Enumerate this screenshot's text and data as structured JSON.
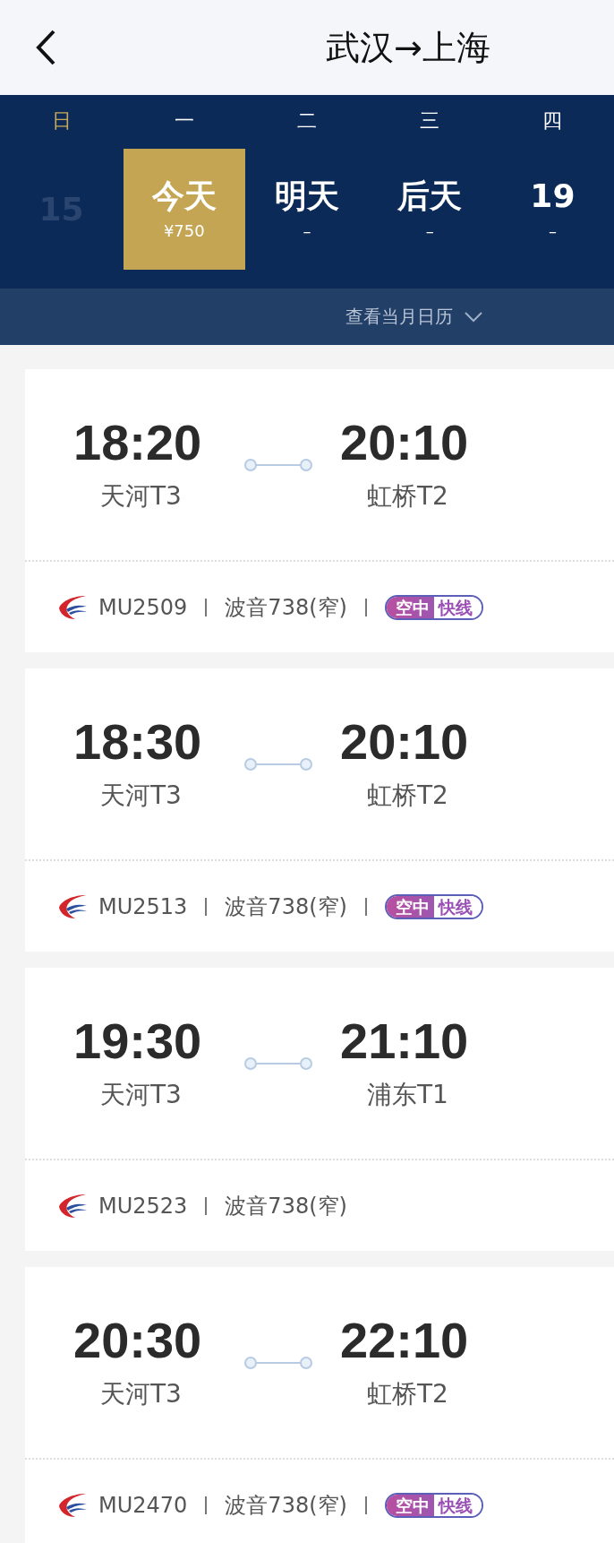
{
  "header": {
    "title": "武汉→上海"
  },
  "days": [
    {
      "weekday": "日",
      "label": "15",
      "weekend": true,
      "disabled": true,
      "selected": false
    },
    {
      "weekday": "一",
      "label": "今天",
      "price": "¥750",
      "weekend": false,
      "disabled": false,
      "selected": true
    },
    {
      "weekday": "二",
      "label": "明天",
      "price": "–",
      "weekend": false,
      "disabled": false,
      "selected": false
    },
    {
      "weekday": "三",
      "label": "后天",
      "price": "–",
      "weekend": false,
      "disabled": false,
      "selected": false
    },
    {
      "weekday": "四",
      "label": "19",
      "price": "–",
      "weekend": false,
      "disabled": false,
      "selected": false
    }
  ],
  "calendar_link": "查看当月日历",
  "flights": [
    {
      "depart": "18:20",
      "depart_airport": "天河T3",
      "arrive": "20:10",
      "arrive_airport": "虹桥T2",
      "number": "MU2509",
      "aircraft": "波音738(窄)",
      "badge": [
        "空中",
        "快线"
      ]
    },
    {
      "depart": "18:30",
      "depart_airport": "天河T3",
      "arrive": "20:10",
      "arrive_airport": "虹桥T2",
      "number": "MU2513",
      "aircraft": "波音738(窄)",
      "badge": [
        "空中",
        "快线"
      ]
    },
    {
      "depart": "19:30",
      "depart_airport": "天河T3",
      "arrive": "21:10",
      "arrive_airport": "浦东T1",
      "number": "MU2523",
      "aircraft": "波音738(窄)"
    },
    {
      "depart": "20:30",
      "depart_airport": "天河T3",
      "arrive": "22:10",
      "arrive_airport": "虹桥T2",
      "number": "MU2470",
      "aircraft": "波音738(窄)",
      "badge": [
        "空中",
        "快线"
      ]
    }
  ]
}
